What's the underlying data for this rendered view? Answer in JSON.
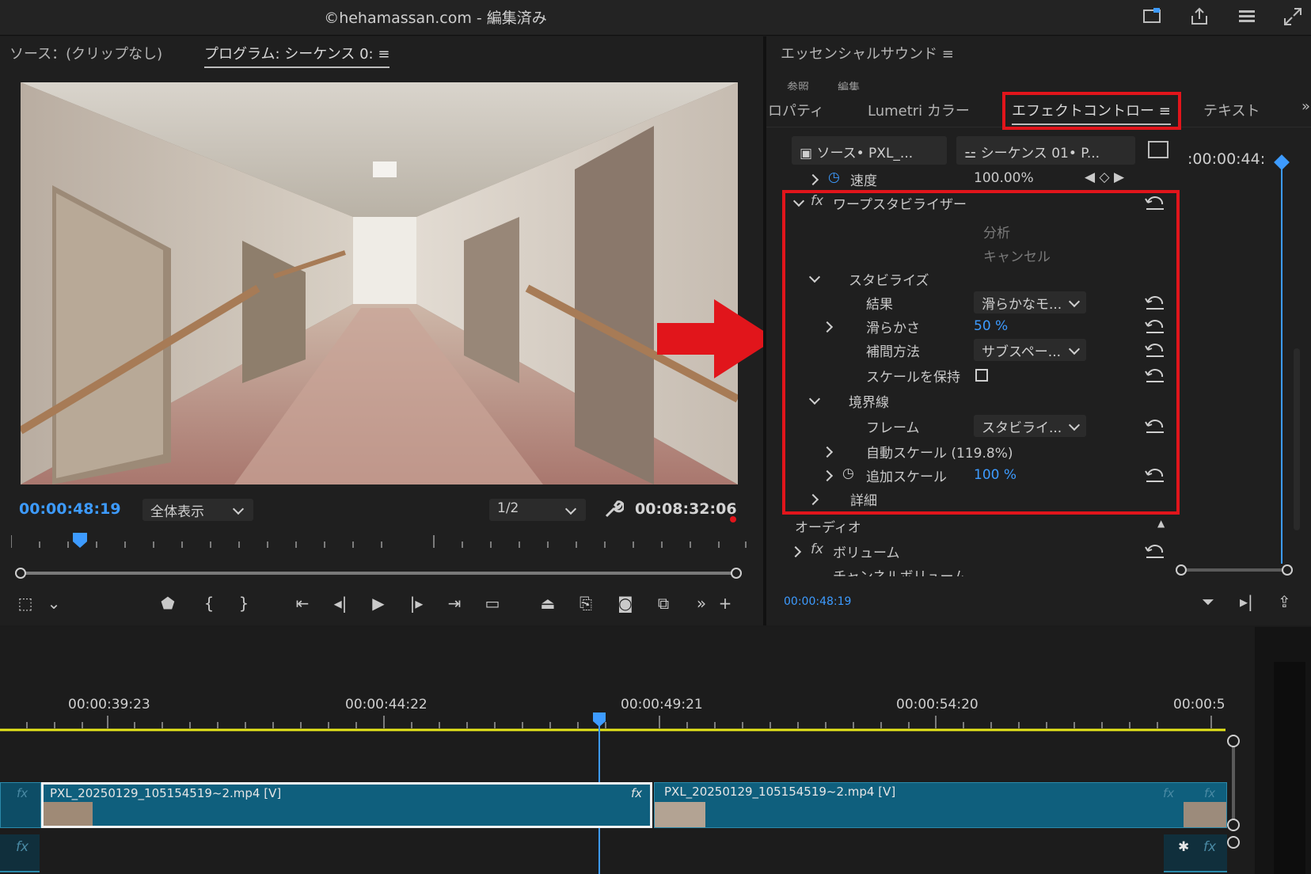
{
  "titlebar": {
    "title": "©hehamassan.com - 編集済み",
    "icons": [
      "monitor-icon",
      "share-icon",
      "menu-icon",
      "fullscreen-icon"
    ]
  },
  "monitor": {
    "tab_source": "ソース：(クリップなし)",
    "tab_program": "プログラム: シーケンス 0:",
    "current_time": "00:00:48:19",
    "zoom_select": "全体表示",
    "resolution_select": "1/2",
    "duration": "00:08:32:06"
  },
  "essential_sound": {
    "title": "エッセンシャルサウンド",
    "sub_tabs": [
      "参照",
      "編集"
    ]
  },
  "effect_panel": {
    "tabs": [
      "ロパティ",
      "Lumetri カラー",
      "エフェクトコントロー",
      "テキスト"
    ],
    "source_label": "ソース• PXL_...",
    "sequence_label": "シーケンス 01• P...",
    "header_time": ":00:00:44:",
    "speed_label": "速度",
    "speed_value": "100.00%",
    "warp_label": "ワープスタビライザー",
    "analyze_btn": "分析",
    "cancel_btn": "キャンセル",
    "stabilize_label": "スタビライズ",
    "result_label": "結果",
    "result_value": "滑らかなモ...",
    "smoothness_label": "滑らかさ",
    "smoothness_value": "50 %",
    "method_label": "補間方法",
    "method_value": "サブスペー...",
    "keep_scale_label": "スケールを保持",
    "border_label": "境界線",
    "frame_label": "フレーム",
    "frame_value": "スタビライ...",
    "auto_scale_label": "自動スケール (119.8%)",
    "add_scale_label": "追加スケール",
    "add_scale_value": "100 %",
    "detail_label": "詳細",
    "audio_label": "オーディオ",
    "volume_label": "ボリューム",
    "channel_volume_label": "チャンネルボリューム",
    "footer_time": "00:00:48:19"
  },
  "timeline": {
    "ruler": [
      "00:00:39:23",
      "00:00:44:22",
      "00:00:49:21",
      "00:00:54:20",
      "00:00:5"
    ],
    "clip1": "PXL_20250129_105154519~2.mp4 [V]",
    "clip2": "PXL_20250129_105154519~2.mp4 [V]",
    "fx": "fx"
  },
  "colors": {
    "accent_blue": "#3d9bff",
    "highlight_red": "#e1151b",
    "clip_blue": "#0f5f7d"
  }
}
